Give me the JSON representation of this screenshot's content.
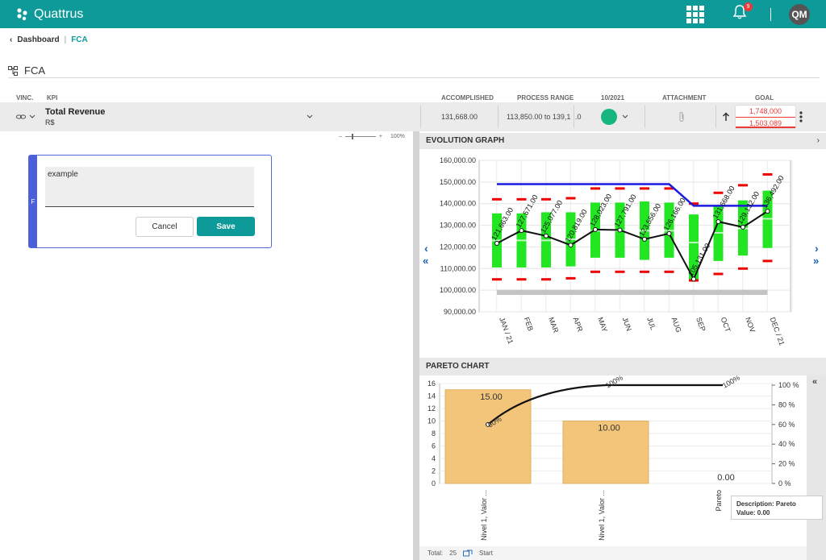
{
  "app": {
    "title": "Quattrus",
    "notifications": "9",
    "user_initials": "QM"
  },
  "breadcrumb": {
    "home": "Dashboard",
    "current": "FCA"
  },
  "page_title": "FCA",
  "table": {
    "headers": {
      "vinc": "VINC.",
      "kpi": "KPI",
      "accomplished": "ACCOMPLISHED",
      "process_range": "PROCESS RANGE",
      "period": "10/2021",
      "attachment": "ATTACHMENT",
      "goal": "GOAL"
    },
    "row": {
      "kpi_name": "Total Revenue",
      "unit": "R$",
      "accomplished": "131,668.00",
      "process_range": "113,850.00 to 139,15",
      "range_cut": ".0",
      "goal_top": "1,748,000",
      "goal_bottom": "1,503,089",
      "status_color": "#17b67e"
    }
  },
  "zoom": {
    "minus": "–",
    "plus": "+",
    "percent": "100%"
  },
  "comment": {
    "badge": "F",
    "text": "example",
    "cancel": "Cancel",
    "save": "Save"
  },
  "evolution": {
    "title": "EVOLUTION GRAPH"
  },
  "pareto": {
    "title": "PARETO CHART"
  },
  "footer": {
    "total_label": "Total:",
    "total": "25",
    "start": "Start"
  },
  "tooltip": {
    "description": "Description: Pareto",
    "value": "Value: 0.00"
  },
  "colors": {
    "brand": "#0f9a9a",
    "accent": "#4a5fd8",
    "goal_red": "#e83a3a"
  },
  "chart_data": [
    {
      "type": "bar",
      "title": "EVOLUTION GRAPH",
      "categories": [
        "JAN / 21",
        "FEB",
        "MAR",
        "APR",
        "MAY",
        "JUN",
        "JUL",
        "AUG",
        "SEP",
        "OCT",
        "NOV",
        "DEC / 21"
      ],
      "ylim": [
        90000,
        160000
      ],
      "yticks": [
        90000,
        100000,
        110000,
        120000,
        130000,
        140000,
        150000,
        160000
      ],
      "ytick_labels": [
        "90,000.00",
        "100,000.00",
        "110,000.00",
        "120,000.00",
        "130,000.00",
        "140,000.00",
        "150,000.00",
        "160,000.00"
      ],
      "range_low": [
        110500,
        110500,
        110500,
        111000,
        115000,
        115000,
        114000,
        115000,
        104500,
        113500,
        116000,
        119500
      ],
      "range_high": [
        135500,
        135500,
        136000,
        136000,
        140500,
        140500,
        141000,
        140500,
        135000,
        139000,
        141500,
        146000
      ],
      "range_mid": [
        123000,
        123000,
        123000,
        123500,
        127500,
        127500,
        127500,
        127500,
        122000,
        126500,
        128500,
        133000
      ],
      "upper_limit": [
        142000,
        142000,
        142000,
        142500,
        147000,
        147000,
        147000,
        147000,
        140000,
        145000,
        148500,
        153500
      ],
      "lower_limit": [
        105000,
        105000,
        105000,
        105500,
        108500,
        108500,
        108500,
        108500,
        104500,
        107500,
        110000,
        113500
      ],
      "goal_line": [
        149000,
        149000,
        149000,
        149000,
        149000,
        149000,
        149000,
        149000,
        139000,
        139000,
        139000,
        139000
      ],
      "baseline": 99000,
      "series": [
        {
          "name": "",
          "values": [
            121663,
            127571,
            125077,
            120819,
            128023,
            127791,
            123556,
            126166,
            105131,
            131668,
            129132,
            136492
          ],
          "labels": [
            "121,663.00",
            "127,571.00",
            "125,077.00",
            "120,819.00",
            "128,023.00",
            "127,791.00",
            "123,556.00",
            "126,166.00",
            "105,131.00",
            "131,668.00",
            "129,132.00",
            "136,492.00"
          ]
        }
      ]
    },
    {
      "type": "bar",
      "title": "PARETO CHART",
      "categories": [
        "Nivel 1, Valor ...",
        "Nivel 1, Valor ...",
        "Pareto"
      ],
      "values": [
        15,
        10,
        0
      ],
      "value_labels": [
        "15.00",
        "10.00",
        "0.00"
      ],
      "cumulative": [
        60,
        100,
        100
      ],
      "cumulative_labels": [
        "60%",
        "100%",
        "100%"
      ],
      "ylim": [
        0,
        16
      ],
      "yticks": [
        0,
        2,
        4,
        6,
        8,
        10,
        12,
        14,
        16
      ],
      "y2ticks": [
        0,
        20,
        40,
        60,
        80,
        100
      ],
      "y2tick_labels": [
        "0 %",
        "20 %",
        "40 %",
        "60 %",
        "80 %",
        "100 %"
      ]
    }
  ]
}
